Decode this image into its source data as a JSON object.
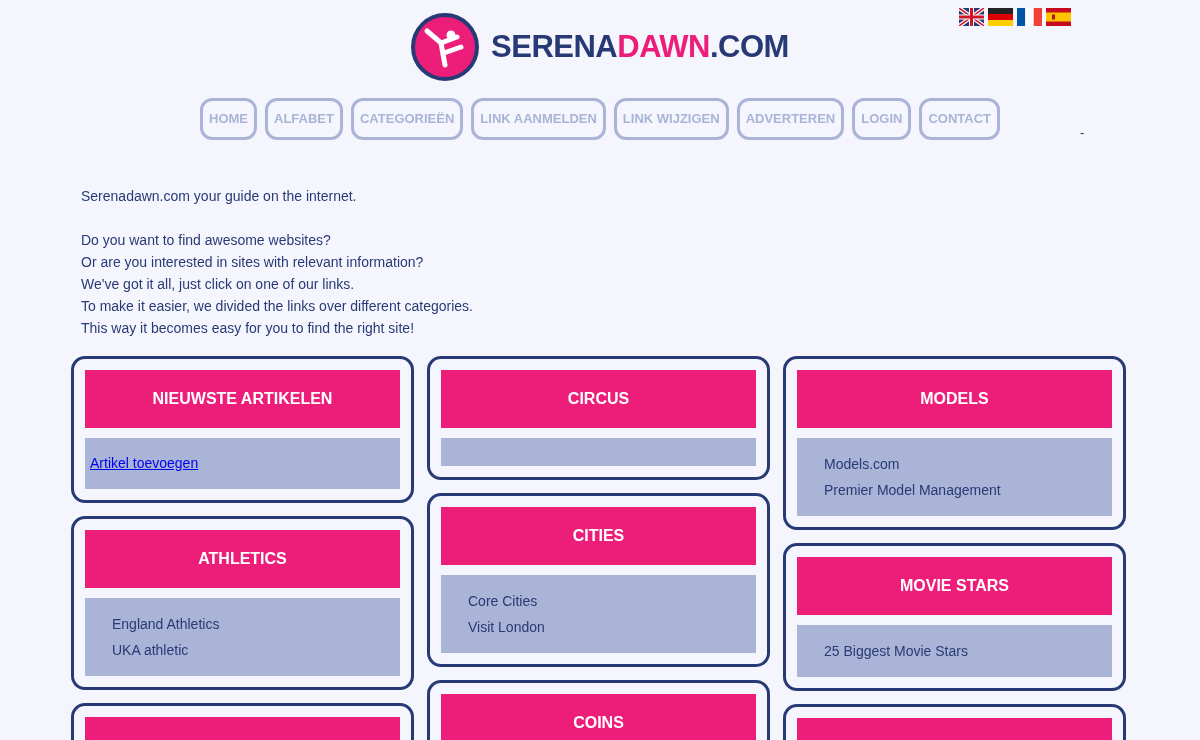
{
  "logo": {
    "parts": [
      {
        "text": "SERENA",
        "color": "#283a75"
      },
      {
        "text": "DAWN",
        "color": "#ec1e79"
      },
      {
        "text": ".COM",
        "color": "#283a75"
      }
    ]
  },
  "nav": [
    "HOME",
    "ALFABET",
    "CATEGORIEËN",
    "LINK AANMELDEN",
    "LINK WIJZIGEN",
    "ADVERTEREN",
    "LOGIN",
    "CONTACT"
  ],
  "nav_extra": "-",
  "intro_lead": "Serenadawn.com your guide on the internet.",
  "intro": [
    "Do you want to find awesome websites?",
    "Or are you interested in sites with relevant information?",
    "We've got it all, just click on one of our links.",
    "To make it easier, we divided the links over different categories.",
    "This way it becomes easy for you to find the right site!"
  ],
  "columns": [
    [
      {
        "kind": "full",
        "title": "NIEUWSTE ARTIKELEN",
        "links": [
          {
            "kind": "anchor",
            "text": "Artikel toevoegen"
          }
        ]
      },
      {
        "kind": "full",
        "title": "ATHLETICS",
        "links": [
          {
            "kind": "item",
            "text": "England Athletics"
          },
          {
            "kind": "item",
            "text": "UKA athletic"
          }
        ]
      },
      {
        "kind": "cut"
      }
    ],
    [
      {
        "kind": "full",
        "title": "CIRCUS"
      },
      {
        "kind": "full",
        "title": "CITIES",
        "links": [
          {
            "kind": "item",
            "text": "Core Cities"
          },
          {
            "kind": "item",
            "text": "Visit London"
          }
        ]
      },
      {
        "kind": "cut",
        "title": "COINS"
      }
    ],
    [
      {
        "kind": "full",
        "title": "MODELS",
        "links": [
          {
            "kind": "item",
            "text": "Models.com"
          },
          {
            "kind": "item",
            "text": "Premier Model Management"
          }
        ]
      },
      {
        "kind": "full",
        "title": "MOVIE STARS",
        "links": [
          {
            "kind": "item",
            "text": "25 Biggest Movie Stars"
          }
        ]
      },
      {
        "kind": "cut"
      }
    ]
  ]
}
